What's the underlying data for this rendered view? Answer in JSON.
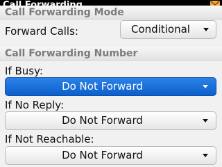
{
  "window": {
    "title": "Call Forwarding"
  },
  "mode_section": {
    "header": "Call Forwarding Mode",
    "forward_calls_label": "Forward Calls:",
    "forward_calls_value": "Conditional"
  },
  "number_section": {
    "header": "Call Forwarding Number",
    "rows": [
      {
        "label": "If Busy:",
        "value": "Do Not Forward",
        "selected": true
      },
      {
        "label": "If No Reply:",
        "value": "Do Not Forward",
        "selected": false
      },
      {
        "label": "If Not Reachable:",
        "value": "Do Not Forward",
        "selected": false
      }
    ]
  },
  "icons": {
    "status": "mail-envelope-icon",
    "dropdown": "chevron-down-icon"
  },
  "colors": {
    "selection": "#1a6fdb",
    "section_header_text": "#7b7b7b",
    "mail_icon": "#f2a93b"
  }
}
